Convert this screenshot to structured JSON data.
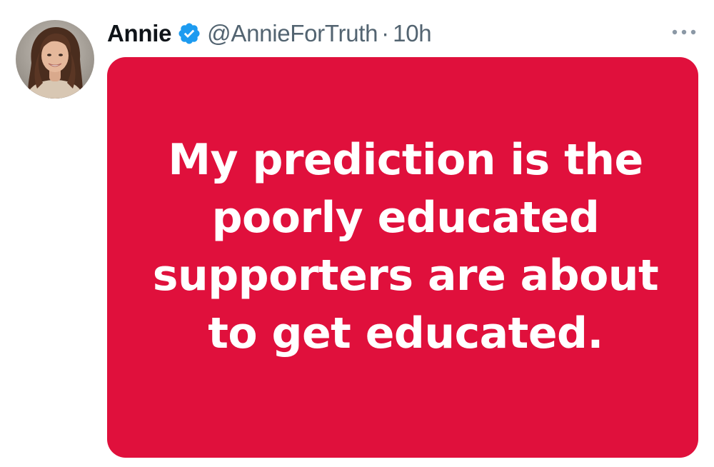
{
  "tweet": {
    "author": {
      "display_name": "Annie",
      "handle": "@AnnieForTruth",
      "verified": true,
      "avatar_icon": "user-avatar"
    },
    "separator": "·",
    "timestamp": "10h",
    "more_icon": "more-horizontal-icon",
    "media": {
      "background_color": "#e0103c",
      "text_color": "#ffffff",
      "text": "My prediction is the poorly educated supporters are about to get educated."
    }
  },
  "colors": {
    "primary_text": "#0f1419",
    "secondary_text": "#536471",
    "verified_badge": "#1d9bf0"
  }
}
